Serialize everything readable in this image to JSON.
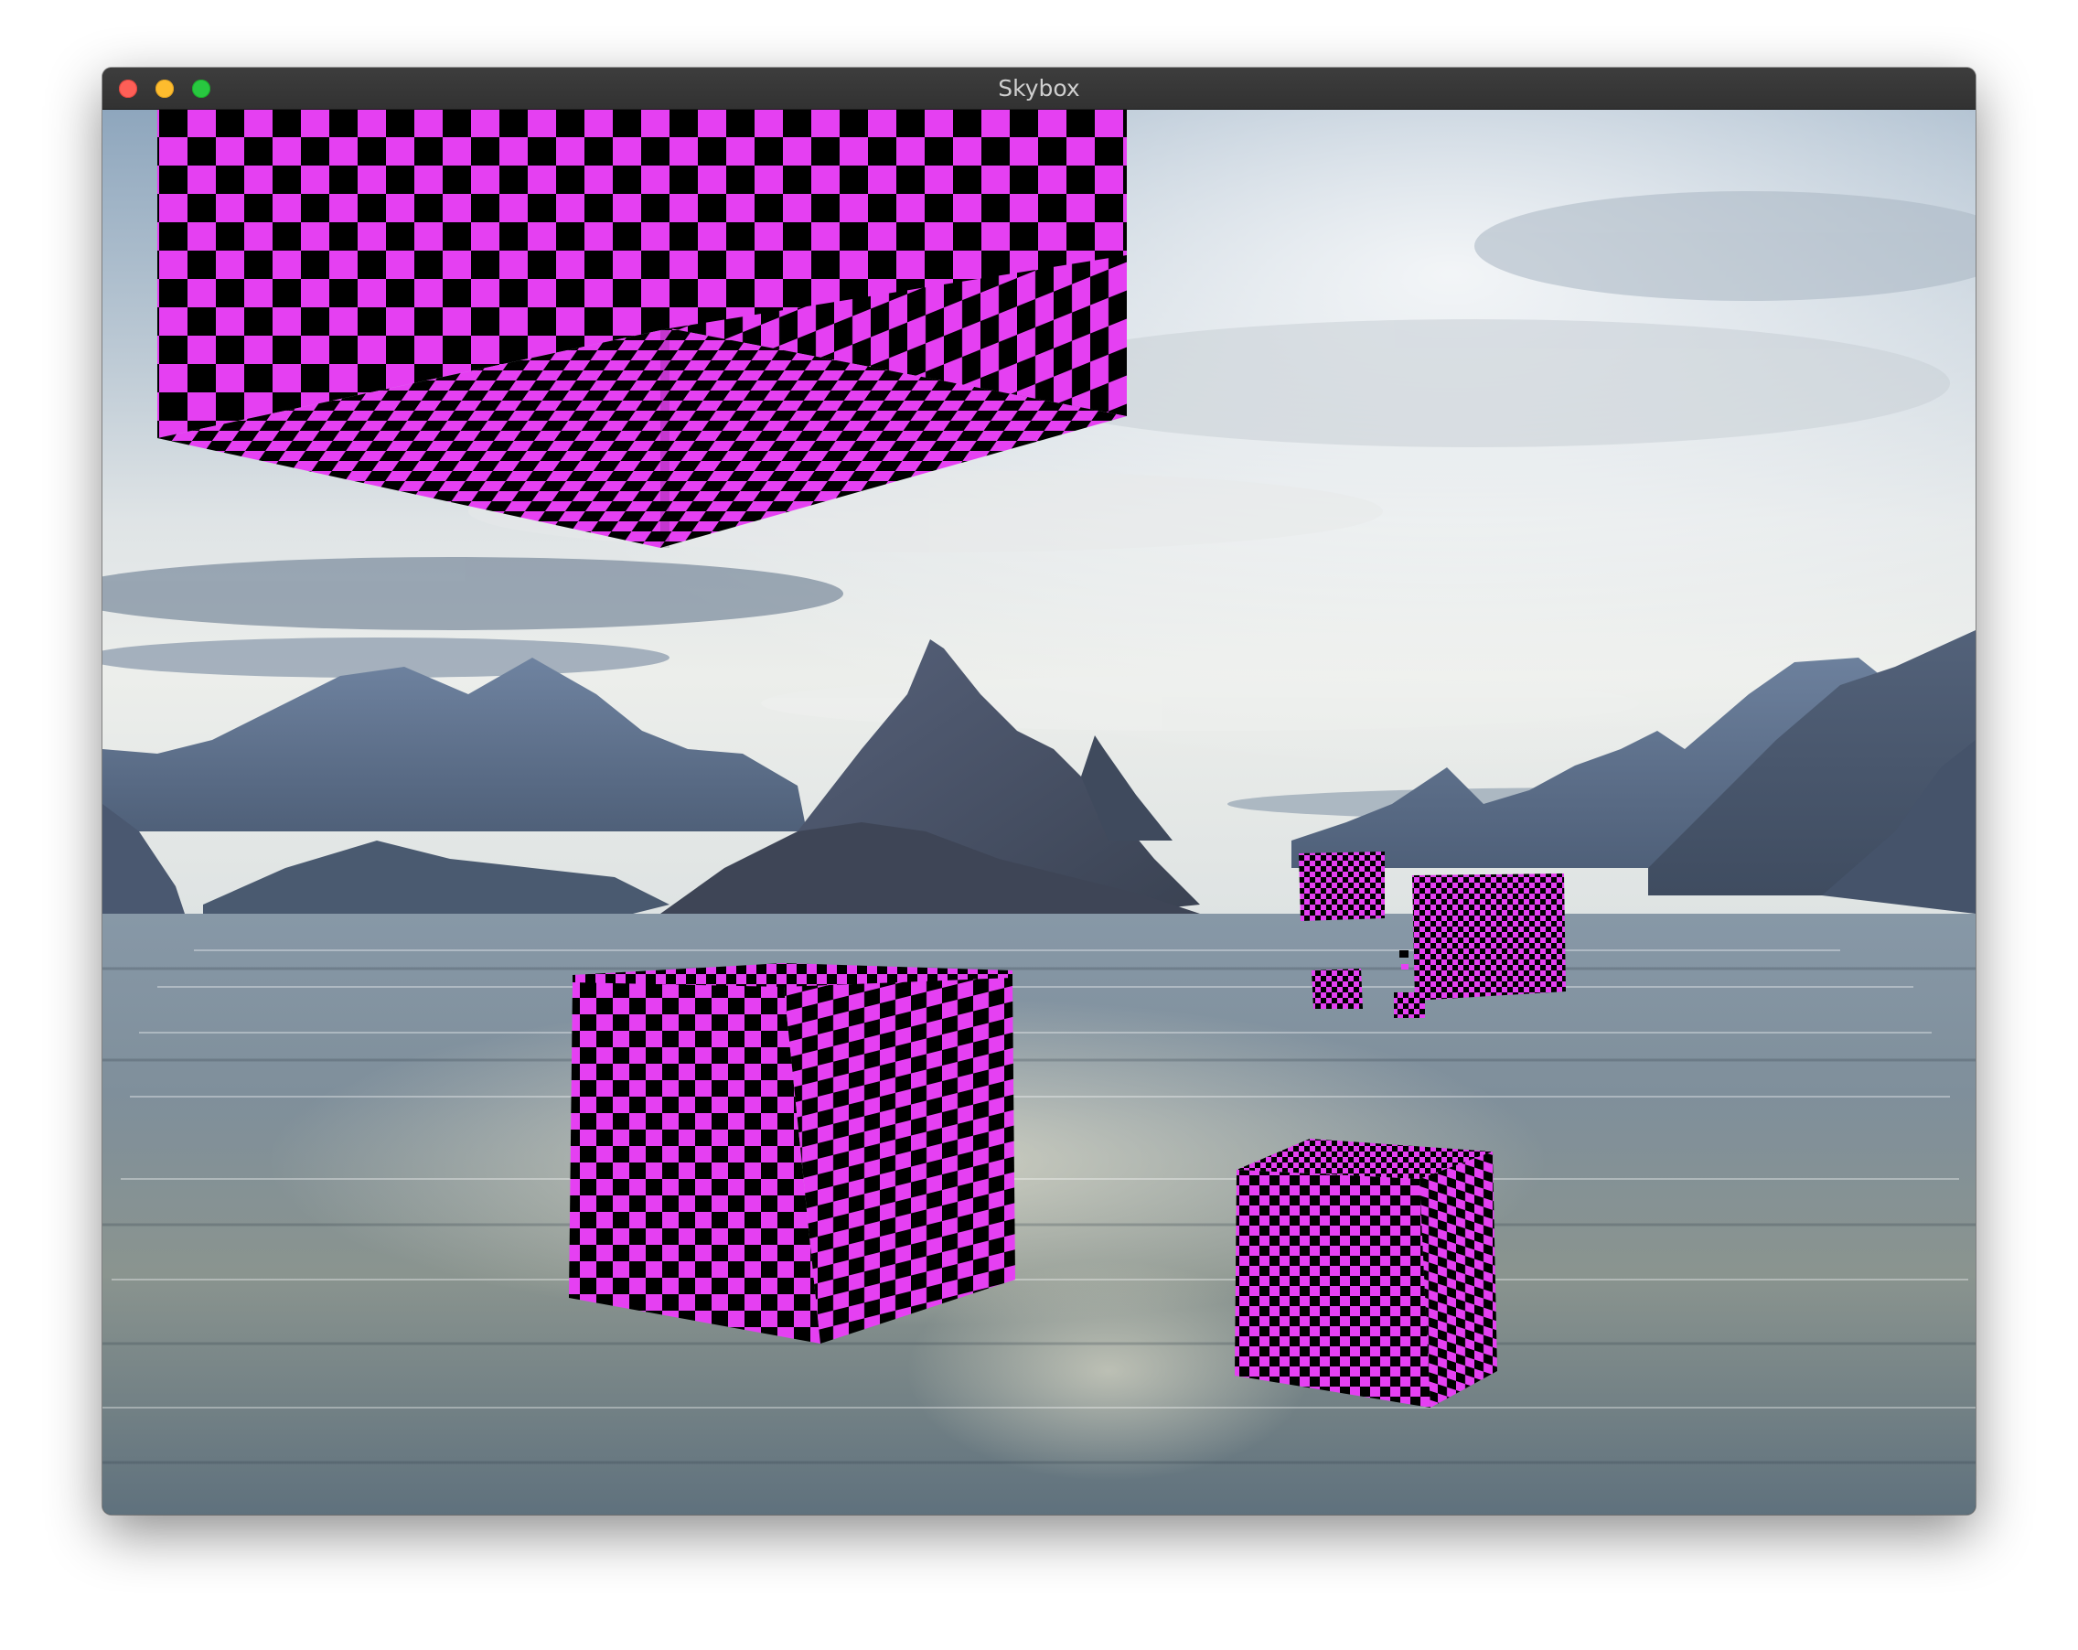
{
  "window": {
    "title": "Skybox",
    "controls": [
      "close-button",
      "minimize-button",
      "zoom-button"
    ]
  },
  "scene": {
    "description_colors": {
      "checker_light": "#e540f2",
      "checker_dark": "#000000",
      "sky_top": "#93a9bc",
      "water": "#6f808d",
      "mountains": "#4a5a72"
    }
  }
}
